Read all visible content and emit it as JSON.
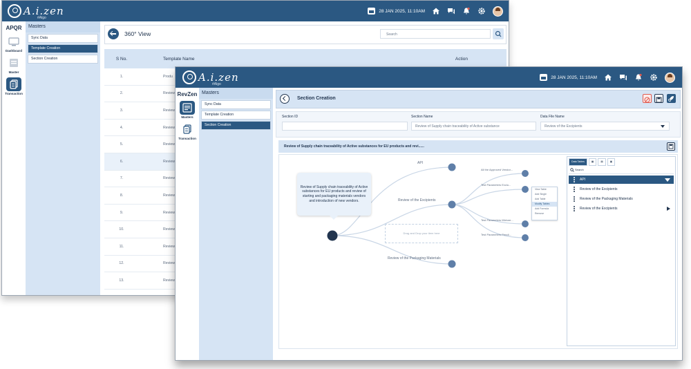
{
  "colors": {
    "brand": "#2b5882",
    "panel": "#d6e4f4",
    "node": "#5f7fa8",
    "accent_red": "#e05a4f"
  },
  "back_window": {
    "logo": {
      "text": "A.i.zen",
      "sub": "#Algo"
    },
    "date": "28 JAN 2025, 11:10AM",
    "rail": {
      "brand": "APQR",
      "items": [
        {
          "label": "Dashboard",
          "icon": "monitor-icon"
        },
        {
          "label": "Master",
          "icon": "master-icon"
        },
        {
          "label": "Transaction",
          "icon": "transaction-icon"
        }
      ]
    },
    "subnav": {
      "heading": "Masters",
      "items": [
        "Sync Data",
        "Template Creation",
        "Section Creation"
      ]
    },
    "view": {
      "title": "360° View",
      "search_placeholder": "Search"
    },
    "table": {
      "headers": [
        "S No.",
        "Template Name",
        "Action"
      ],
      "rows": [
        {
          "no": "1.",
          "name": "Produ"
        },
        {
          "no": "2.",
          "name": "Review"
        },
        {
          "no": "3.",
          "name": "Review"
        },
        {
          "no": "4.",
          "name": "Review"
        },
        {
          "no": "5.",
          "name": "Review"
        },
        {
          "no": "6.",
          "name": "Review"
        },
        {
          "no": "7.",
          "name": "Review"
        },
        {
          "no": "8.",
          "name": "Review"
        },
        {
          "no": "9.",
          "name": "Review"
        },
        {
          "no": "10.",
          "name": "Review"
        },
        {
          "no": "11.",
          "name": "Review"
        },
        {
          "no": "12.",
          "name": "Review"
        },
        {
          "no": "13.",
          "name": "Review"
        }
      ]
    }
  },
  "front_window": {
    "logo": {
      "text": "A.i.zen",
      "sub": "#Algo"
    },
    "date": "28 JAN 2025, 11:10AM",
    "rail": {
      "brand": "RevZen",
      "items": [
        {
          "label": "Masters",
          "icon": "masters-icon"
        },
        {
          "label": "Transaction",
          "icon": "transaction-icon"
        }
      ]
    },
    "subnav": {
      "heading": "Masters",
      "items": [
        "Sync Data",
        "Template Creation",
        "Section Creation"
      ]
    },
    "header": {
      "title": "Section Creation"
    },
    "form": {
      "section_id": {
        "label": "Section ID",
        "value": ""
      },
      "section_name": {
        "label": "Section Name",
        "value": "Review of Supply chain traceability of Active substance"
      },
      "data_file": {
        "label": "Data File Name",
        "value": "Review of the Excipients"
      }
    },
    "description": "Review of Supply chain traceability of Active substances for EU products and revi......",
    "mindmap": {
      "root": "Review of Supply chain traceability of Active substances for EU products and review of starting and  packaging materials vendors and introduction of new vendors.",
      "branches": [
        "API",
        "Review of the Excipients",
        "Review of the Packaging Materials"
      ],
      "leaves": [
        "All the Approved Vendor...",
        "Test Parameters Exclu...",
        "Test Parameters Mixture...",
        "Test Parameters Pendi..."
      ],
      "dropzone": "Drag and Drop your item here",
      "context_menu": [
        "View Table",
        "Add Single",
        "Add Table",
        "Modify Tables",
        "Add Formula",
        "Remove"
      ],
      "context_menu_active": "Modify Tables"
    },
    "right_panel": {
      "tab": "Data Tables",
      "search": "Search",
      "items": [
        "API",
        "Review of the Excipients",
        "Review of the Packaging Materials",
        "Review of the Excipients"
      ]
    }
  }
}
